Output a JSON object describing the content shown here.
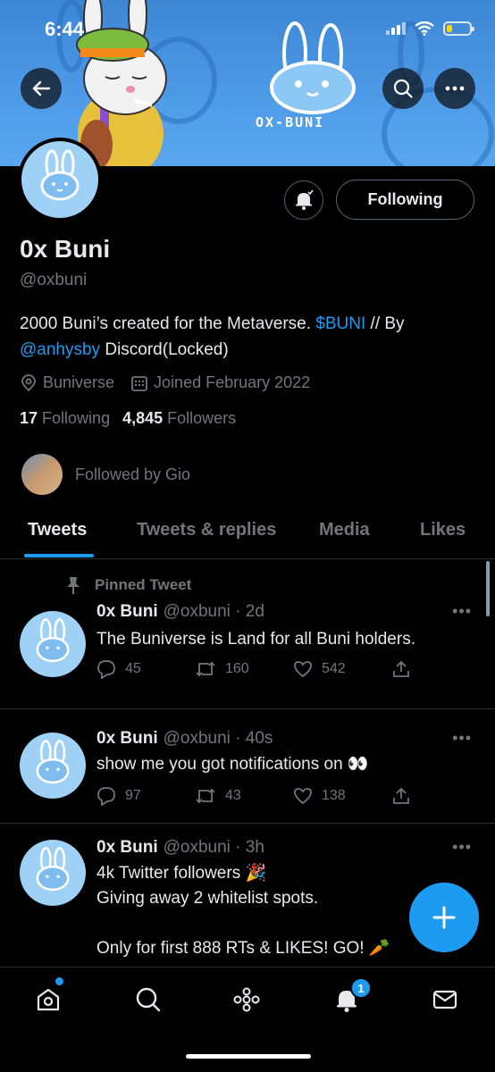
{
  "status_bar": {
    "time": "6:44"
  },
  "banner": {
    "logo_text": "OX-BUNI"
  },
  "profile": {
    "follow_button": "Following",
    "display_name": "0x Buni",
    "handle": "@oxbuni",
    "bio_text_1": "2000 Buni’s created for the Metaverse. ",
    "bio_link_1": "$BUNI",
    "bio_text_2": " // By ",
    "bio_link_2": "@anhysby",
    "bio_text_3": " Discord(Locked)",
    "location": "Buniverse",
    "joined": "Joined February 2022",
    "following_count": "17",
    "following_label": "Following",
    "followers_count": "4,845",
    "followers_label": "Followers",
    "followed_by": "Followed by Gio"
  },
  "tabs": [
    {
      "label": "Tweets",
      "active": true
    },
    {
      "label": "Tweets & replies",
      "active": false
    },
    {
      "label": "Media",
      "active": false
    },
    {
      "label": "Likes",
      "active": false
    }
  ],
  "pinned_label": "Pinned Tweet",
  "tweets": [
    {
      "name": "0x Buni",
      "meta": "@oxbuni · 2d",
      "text": "The Buniverse is Land for all Buni holders.",
      "replies": "45",
      "retweets": "160",
      "likes": "542"
    },
    {
      "name": "0x Buni",
      "meta": "@oxbuni · 40s",
      "text": "show me you got notifications on 👀",
      "replies": "97",
      "retweets": "43",
      "likes": "138"
    },
    {
      "name": "0x Buni",
      "meta": "@oxbuni · 3h",
      "line1": "4k Twitter followers 🎉",
      "line2": "Giving away 2 whitelist spots.",
      "line3": "Only for first 888 RTs & LIKES! GO! 🥕"
    }
  ],
  "notifications_badge": "1",
  "icons": [
    "back-arrow-icon",
    "search-icon",
    "more-icon",
    "bell-icon",
    "location-icon",
    "calendar-icon",
    "pin-icon",
    "reply-icon",
    "retweet-icon",
    "like-icon",
    "share-icon",
    "compose-icon",
    "home-icon",
    "explore-icon",
    "spaces-icon",
    "notifications-icon",
    "messages-icon"
  ],
  "colors": {
    "accent": "#1d9bf0",
    "background": "#000000",
    "secondary_text": "#71767b",
    "banner": "#4e9be8"
  }
}
